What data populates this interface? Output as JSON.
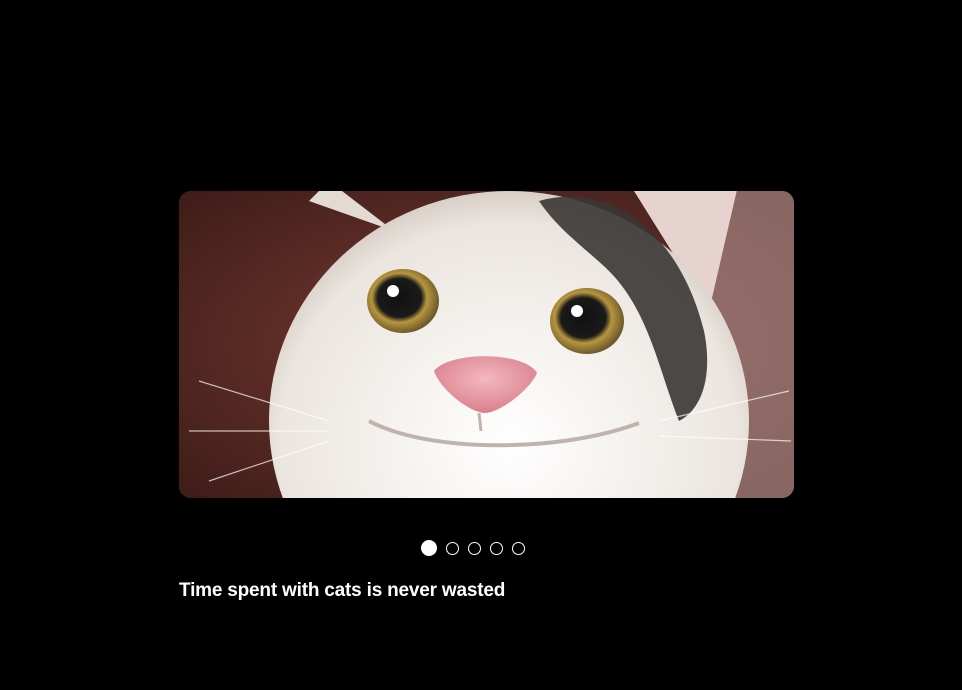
{
  "slideshow": {
    "image": {
      "subject": "smiling-cat-photo",
      "colors": {
        "background": "#5a2a24",
        "fur": "#f3efea",
        "patch": "#3a3634",
        "nose": "#e8a0a8",
        "eye": "#c9a24a"
      }
    },
    "dots": [
      {
        "active": true
      },
      {
        "active": false
      },
      {
        "active": false
      },
      {
        "active": false
      },
      {
        "active": false
      }
    ],
    "caption": "Time spent with cats is never wasted"
  }
}
